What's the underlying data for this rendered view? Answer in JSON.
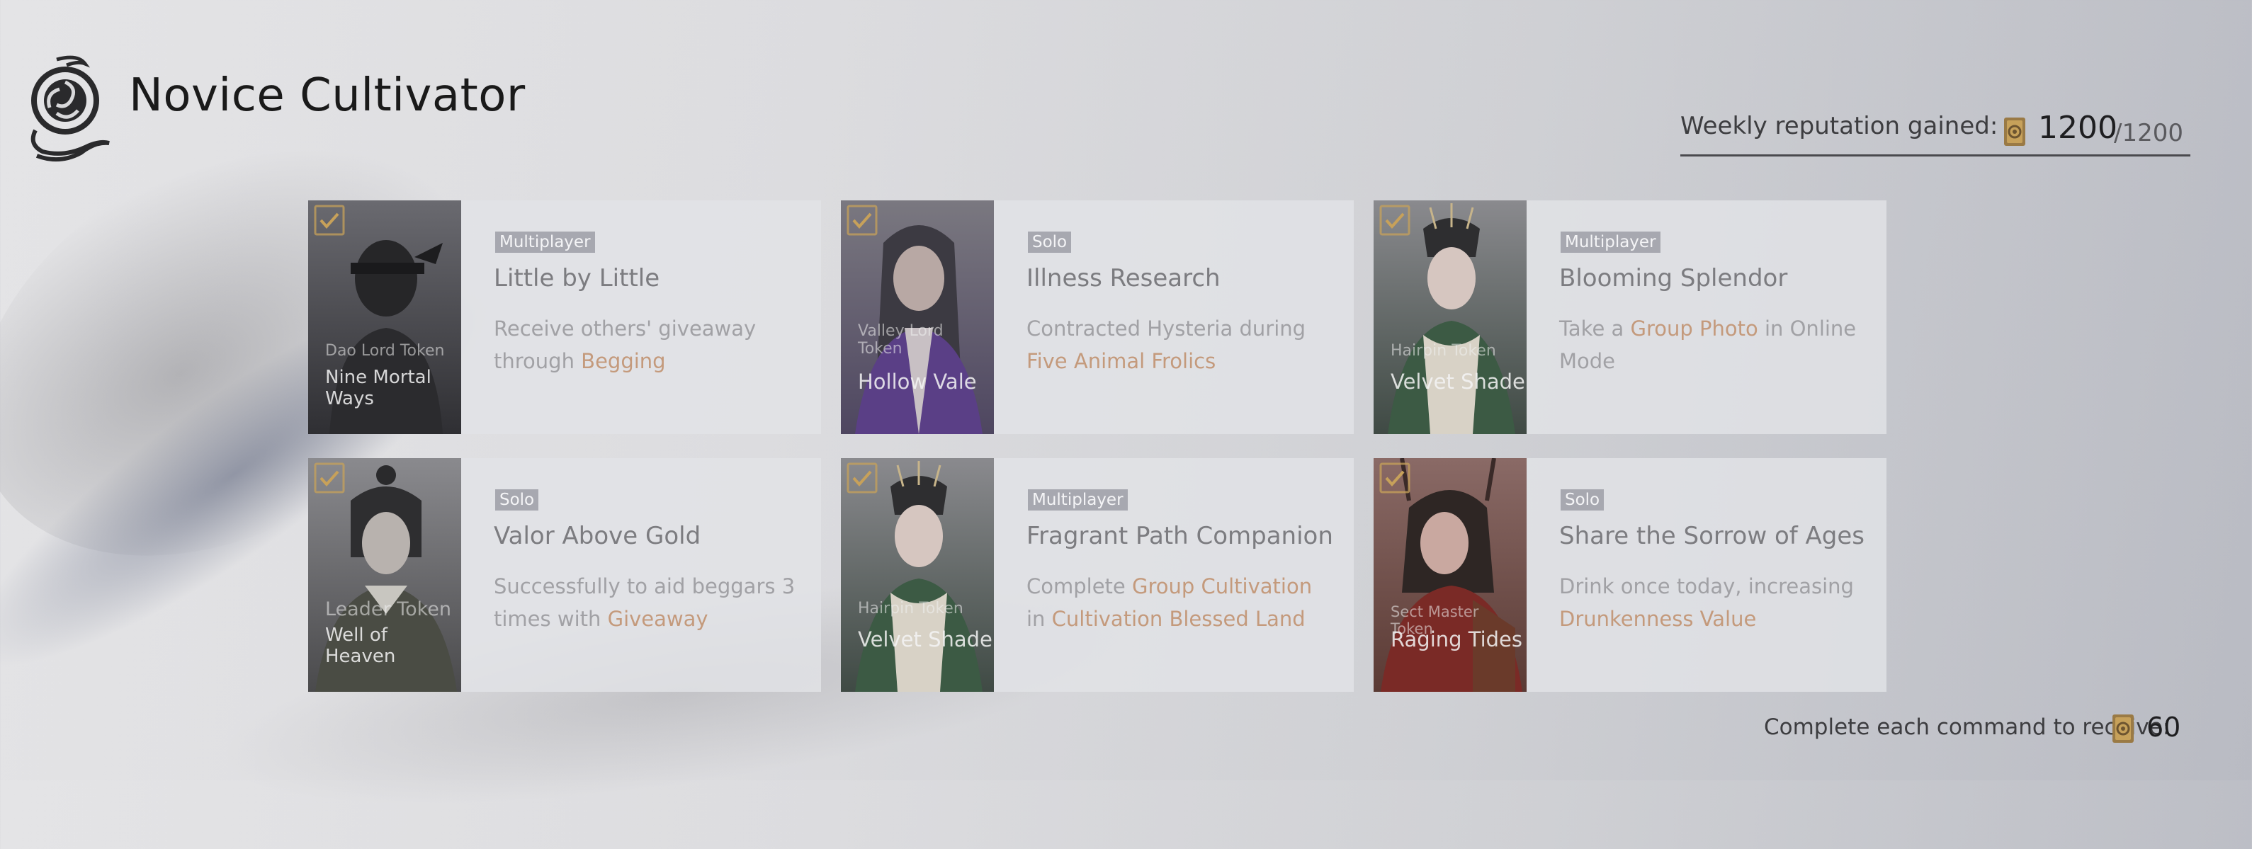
{
  "header": {
    "title": "Novice Cultivator",
    "weekly_label": "Weekly reputation gained:",
    "weekly_value": "1200",
    "weekly_max": "/1200"
  },
  "colors": {
    "accent_highlight": "#c49a7c",
    "badge_bg": "#a7a8b0",
    "completed_check": "#c7a15a"
  },
  "commands": [
    {
      "completed": true,
      "mode": "Multiplayer",
      "title": "Little by Little",
      "desc_before": "Receive others' giveaway through ",
      "desc_highlight": "Begging",
      "desc_middle": "",
      "desc_highlight2": "",
      "desc_after": "",
      "token_type": "Dao Lord Token",
      "token_name": "Nine Mortal Ways"
    },
    {
      "completed": true,
      "mode": "Solo",
      "title": "Illness Research",
      "desc_before": "Contracted Hysteria during ",
      "desc_highlight": "Five Animal Frolics",
      "desc_middle": "",
      "desc_highlight2": "",
      "desc_after": "",
      "token_type": "Valley Lord Token",
      "token_name": "Hollow Vale"
    },
    {
      "completed": true,
      "mode": "Multiplayer",
      "title": "Blooming Splendor",
      "desc_before": "Take a ",
      "desc_highlight": "Group Photo",
      "desc_middle": " in Online Mode",
      "desc_highlight2": "",
      "desc_after": "",
      "token_type": "Hairpin Token",
      "token_name": "Velvet Shade"
    },
    {
      "completed": true,
      "mode": "Solo",
      "title": "Valor Above Gold",
      "desc_before": "Successfully to aid beggars 3 times with ",
      "desc_highlight": "Giveaway",
      "desc_middle": "",
      "desc_highlight2": "",
      "desc_after": "",
      "token_type": "Leader Token",
      "token_name": "Well of Heaven"
    },
    {
      "completed": true,
      "mode": "Multiplayer",
      "title": "Fragrant Path Companion",
      "desc_before": "Complete ",
      "desc_highlight": "Group Cultivation",
      "desc_middle": " in ",
      "desc_highlight2": "Cultivation Blessed Land",
      "desc_after": "",
      "token_type": "Hairpin Token",
      "token_name": "Velvet Shade"
    },
    {
      "completed": true,
      "mode": "Solo",
      "title": "Share the Sorrow of Ages",
      "desc_before": "Drink once today, increasing ",
      "desc_highlight": "Drunkenness Value",
      "desc_middle": "",
      "desc_highlight2": "",
      "desc_after": "",
      "token_type": "Sect Master Token",
      "token_name": "Raging Tides"
    }
  ],
  "footer": {
    "label": "Complete each command to receive:",
    "value": "60"
  },
  "icons": {
    "logo": "swirl-emblem-icon",
    "reputation": "reputation-token-icon",
    "check": "check-icon"
  }
}
